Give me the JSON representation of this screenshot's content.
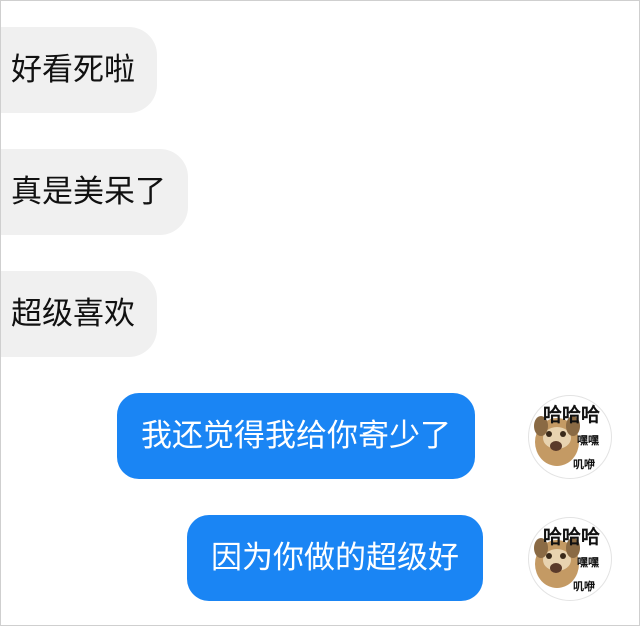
{
  "conversation": {
    "incoming": [
      {
        "text": "好看死啦"
      },
      {
        "text": "真是美呆了"
      },
      {
        "text": "超级喜欢"
      }
    ],
    "outgoing": [
      {
        "text": "我还觉得我给你寄少了"
      },
      {
        "text": "因为你做的超级好"
      }
    ]
  },
  "avatar": {
    "sticker_top": "哈哈哈",
    "sticker_mid": "嘿嘿",
    "sticker_bot": "叽咿"
  },
  "colors": {
    "incoming_bubble": "#f0f0f0",
    "outgoing_bubble": "#1a85f4",
    "background": "#ffffff"
  }
}
